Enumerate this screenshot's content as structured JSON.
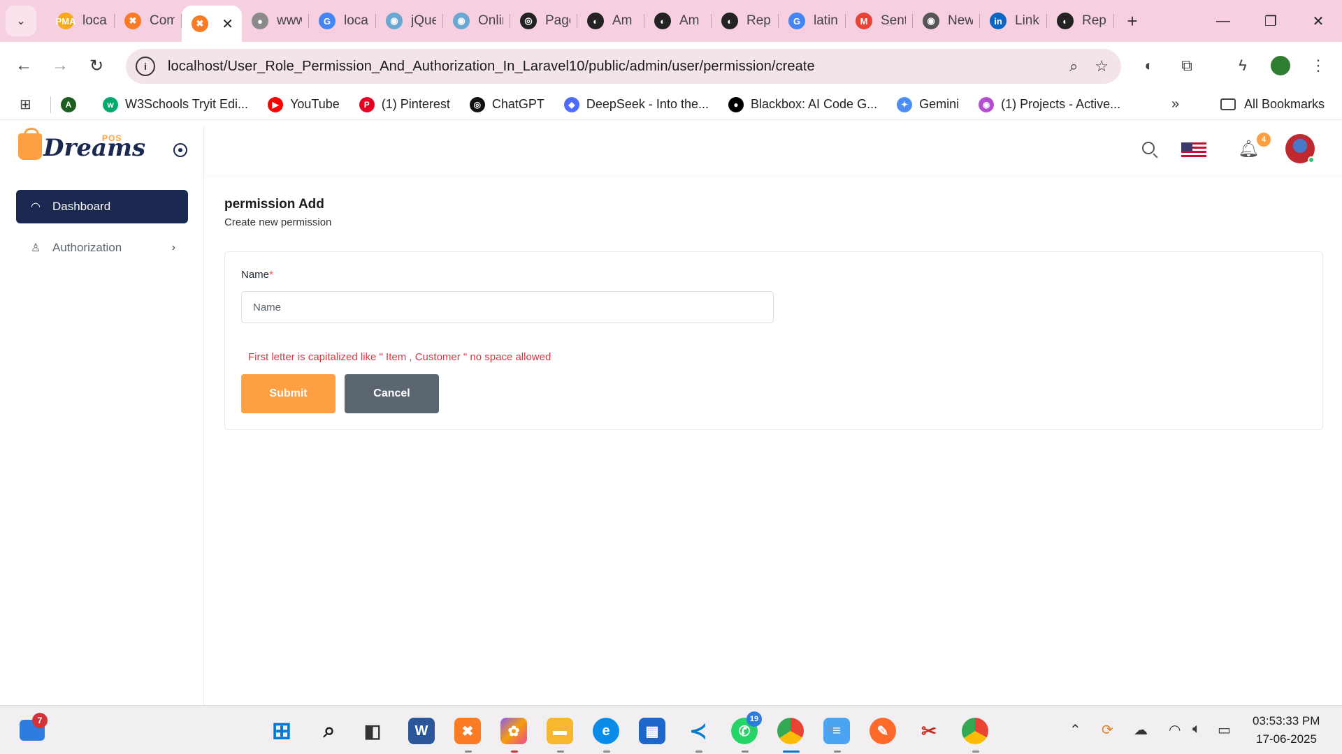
{
  "browser": {
    "tabs": [
      {
        "title": "localhost",
        "fav": "PMA",
        "color": "#f7a81b"
      },
      {
        "title": "Compo",
        "fav": "✖",
        "color": "#fb7a24"
      },
      {
        "title": "",
        "fav": "✖",
        "color": "#fb7a24",
        "active": true
      },
      {
        "title": "www",
        "fav": "●",
        "color": "#8a8a8a"
      },
      {
        "title": "localhost",
        "fav": "G",
        "color": "#4285f4"
      },
      {
        "title": "jQuery",
        "fav": "◉",
        "color": "#6aa8d4"
      },
      {
        "title": "Online",
        "fav": "◉",
        "color": "#6aa8d4"
      },
      {
        "title": "Page",
        "fav": "◎",
        "color": "#222222"
      },
      {
        "title": "Am",
        "fav": "◐",
        "color": "#222222"
      },
      {
        "title": "Am",
        "fav": "◐",
        "color": "#222222"
      },
      {
        "title": "Rep",
        "fav": "◐",
        "color": "#222222"
      },
      {
        "title": "latin",
        "fav": "G",
        "color": "#4285f4"
      },
      {
        "title": "Sent",
        "fav": "M",
        "color": "#ea4335"
      },
      {
        "title": "New",
        "fav": "◉",
        "color": "#555555"
      },
      {
        "title": "LinkedIn",
        "fav": "in",
        "color": "#0a66c2"
      },
      {
        "title": "Rep",
        "fav": "◐",
        "color": "#222222"
      }
    ],
    "tab_close_glyph": "✕",
    "new_tab_glyph": "+",
    "url": "localhost/User_Role_Permission_And_Authorization_In_Laravel10/public/admin/user/permission/create",
    "bookmarks": [
      {
        "label": "",
        "icon": "A",
        "color": "#1b5e20"
      },
      {
        "label": "W3Schools Tryit Edi...",
        "icon": "w",
        "color": "#04aa6d"
      },
      {
        "label": "YouTube",
        "icon": "▶",
        "color": "#ff0000"
      },
      {
        "label": "(1) Pinterest",
        "icon": "P",
        "color": "#e60023"
      },
      {
        "label": "ChatGPT",
        "icon": "◎",
        "color": "#111111"
      },
      {
        "label": "DeepSeek - Into the...",
        "icon": "◆",
        "color": "#4d6bfe"
      },
      {
        "label": "Blackbox: AI Code G...",
        "icon": "●",
        "color": "#000000"
      },
      {
        "label": "Gemini",
        "icon": "✦",
        "color": "#4c8df6"
      },
      {
        "label": "(1) Projects - Active...",
        "icon": "◉",
        "color": "#b44fd1"
      }
    ],
    "more_bookmarks": "»",
    "all_bookmarks": "All Bookmarks"
  },
  "sidebar": {
    "logo_text": "Dreams",
    "logo_tag": "POS",
    "items": [
      {
        "label": "Dashboard",
        "icon": "dashboard-icon",
        "active": true
      },
      {
        "label": "Authorization",
        "icon": "user-icon",
        "has_children": true
      }
    ]
  },
  "header": {
    "notification_count": "4"
  },
  "page": {
    "title": "permission Add",
    "subtitle": "Create new permission",
    "form": {
      "name_label": "Name",
      "required_marker": "*",
      "name_placeholder": "Name",
      "name_value": "",
      "hint": "First letter is capitalized like \" Item , Customer \" no space allowed",
      "submit_label": "Submit",
      "cancel_label": "Cancel"
    }
  },
  "colors": {
    "primary": "#fe9f43",
    "sidebar_active": "#1b2850",
    "secondary": "#5b6670",
    "danger": "#dc3545"
  },
  "taskbar": {
    "widget_badge": "7",
    "whatsapp_badge": "19",
    "time": "03:53:33 PM",
    "date": "17-06-2025"
  }
}
